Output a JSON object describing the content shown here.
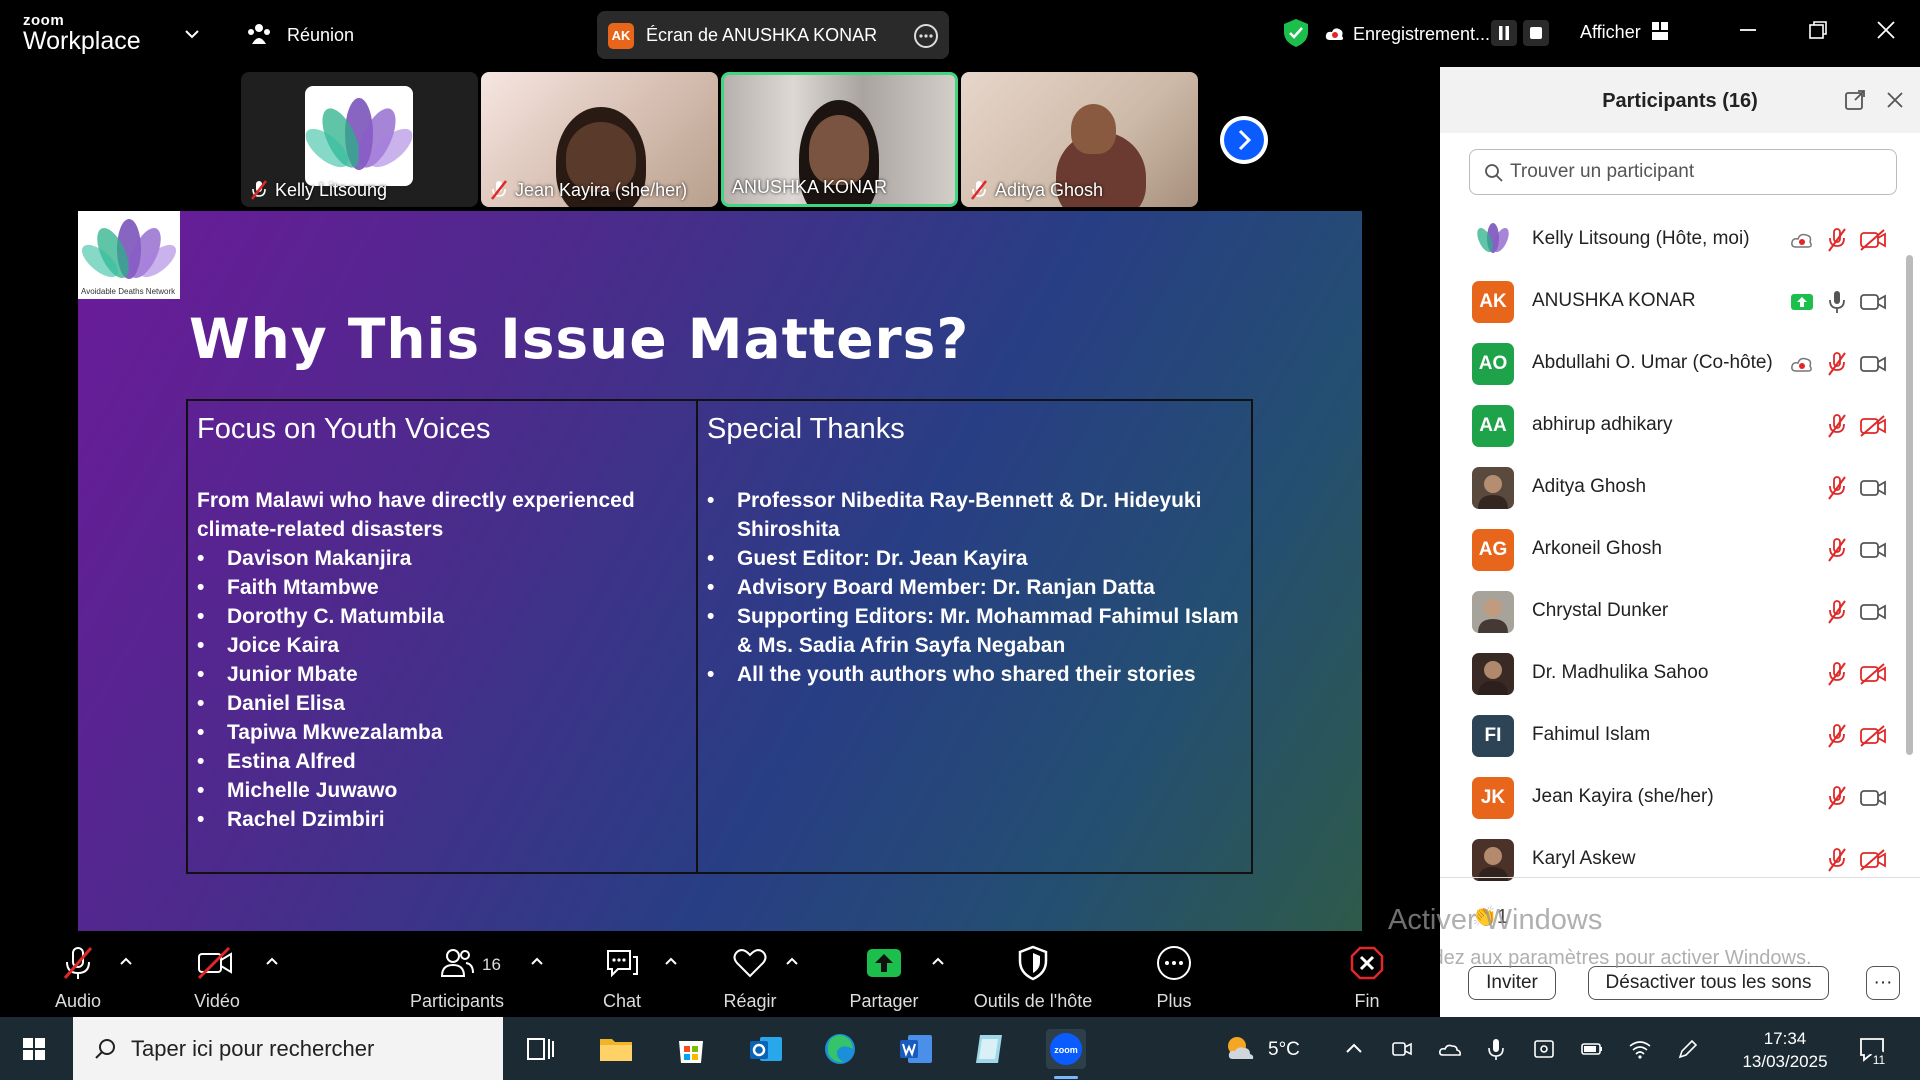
{
  "app": {
    "brand_small": "zoom",
    "brand_big": "Workplace",
    "meeting_label": "Réunion"
  },
  "share": {
    "initials": "AK",
    "label": "Écran de ANUSHKA KONAR"
  },
  "recording": {
    "label": "Enregistrement..."
  },
  "view": {
    "label": "Afficher"
  },
  "thumbnails": [
    {
      "name": "Kelly Litsoung",
      "muted": true
    },
    {
      "name": "Jean Kayira (she/her)",
      "muted": true
    },
    {
      "name": "ANUSHKA KONAR",
      "muted": false
    },
    {
      "name": "Aditya Ghosh",
      "muted": true
    }
  ],
  "slide": {
    "logo_tag": "Avoidable Deaths Network",
    "title": "Why This Issue Matters?",
    "left": {
      "heading": "Focus on Youth Voices",
      "intro": "From Malawi who have directly experienced climate-related disasters",
      "items": [
        "Davison Makanjira",
        "Faith Mtambwe",
        "Dorothy C. Matumbila",
        "Joice Kaira",
        "Junior Mbate",
        "Daniel Elisa",
        "Tapiwa Mkwezalamba",
        "Estina Alfred",
        "Michelle Juwawo",
        "Rachel Dzimbiri"
      ]
    },
    "right": {
      "heading": "Special Thanks",
      "items": [
        "Professor Nibedita Ray-Bennett & Dr. Hideyuki Shiroshita",
        "Guest Editor: Dr. Jean Kayira",
        "Advisory Board Member: Dr. Ranjan Datta",
        "Supporting Editors: Mr. Mohammad Fahimul Islam & Ms. Sadia Afrin Sayfa Negaban",
        "All the youth authors who shared their stories"
      ]
    }
  },
  "panel": {
    "title": "Participants (16)",
    "search_placeholder": "Trouver un participant",
    "participants": [
      {
        "name": "Kelly Litsoung (Hôte, moi)",
        "initials": "",
        "color": "#ffffff",
        "mic": "muted",
        "cam": "off",
        "extra": "rec"
      },
      {
        "name": "ANUSHKA KONAR",
        "initials": "AK",
        "color": "#e8661c",
        "mic": "on",
        "cam": "on",
        "extra": "share"
      },
      {
        "name": "Abdullahi O. Umar (Co-hôte)",
        "initials": "AO",
        "color": "#1fa34a",
        "mic": "muted",
        "cam": "on",
        "extra": "rec"
      },
      {
        "name": "abhirup adhikary",
        "initials": "AA",
        "color": "#1fa34a",
        "mic": "muted",
        "cam": "off",
        "extra": ""
      },
      {
        "name": "Aditya Ghosh",
        "initials": "",
        "color": "#5a4a3e",
        "mic": "muted",
        "cam": "on",
        "extra": ""
      },
      {
        "name": "Arkoneil Ghosh",
        "initials": "AG",
        "color": "#e8661c",
        "mic": "muted",
        "cam": "on",
        "extra": ""
      },
      {
        "name": "Chrystal Dunker",
        "initials": "",
        "color": "#a8a39a",
        "mic": "muted",
        "cam": "on",
        "extra": ""
      },
      {
        "name": "Dr. Madhulika Sahoo",
        "initials": "",
        "color": "#3a2a26",
        "mic": "muted",
        "cam": "off",
        "extra": ""
      },
      {
        "name": "Fahimul Islam",
        "initials": "FI",
        "color": "#2d4457",
        "mic": "muted",
        "cam": "off",
        "extra": ""
      },
      {
        "name": "Jean Kayira (she/her)",
        "initials": "JK",
        "color": "#e8661c",
        "mic": "muted",
        "cam": "on",
        "extra": ""
      },
      {
        "name": "Karyl Askew",
        "initials": "",
        "color": "#4a3228",
        "mic": "muted",
        "cam": "off",
        "extra": ""
      }
    ],
    "reaction": "👏1",
    "invite_label": "Inviter",
    "mute_all_label": "Désactiver tous les sons",
    "more_label": "···"
  },
  "watermark": {
    "line1": "Activer Windows",
    "line2": "Accédez aux paramètres pour activer Windows."
  },
  "toolbar": {
    "audio": "Audio",
    "video": "Vidéo",
    "participants": "Participants",
    "participants_count": "16",
    "chat": "Chat",
    "react": "Réagir",
    "share": "Partager",
    "host_tools": "Outils de l'hôte",
    "more": "Plus",
    "end": "Fin"
  },
  "taskbar": {
    "search_placeholder": "Taper ici pour rechercher",
    "temperature": "5°C",
    "time": "17:34",
    "date": "13/03/2025",
    "notifications": "11"
  },
  "colors": {
    "accent": "#0b5cff",
    "green": "#1fa34a",
    "orange": "#e8661c",
    "mute_red": "#e02828",
    "share_green": "#1dbf4c"
  }
}
